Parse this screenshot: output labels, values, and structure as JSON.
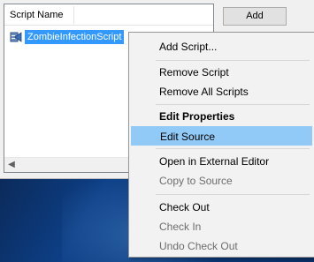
{
  "list": {
    "column_header": "Script Name",
    "items": [
      {
        "label": "ZombieInfectionScript",
        "icon": "script-icon",
        "selected": true
      }
    ]
  },
  "buttons": {
    "add_label": "Add"
  },
  "context_menu": {
    "items": [
      {
        "label": "Add Script...",
        "enabled": true
      },
      {
        "label": "Remove Script",
        "enabled": true
      },
      {
        "label": "Remove All Scripts",
        "enabled": true
      },
      {
        "label": "Edit Properties",
        "enabled": true,
        "bold": true
      },
      {
        "label": "Edit Source",
        "enabled": true,
        "highlighted": true
      },
      {
        "label": "Open in External Editor",
        "enabled": true
      },
      {
        "label": "Copy to Source",
        "enabled": false
      },
      {
        "label": "Check Out",
        "enabled": true
      },
      {
        "label": "Check In",
        "enabled": false
      },
      {
        "label": "Undo Check Out",
        "enabled": false
      }
    ]
  },
  "colors": {
    "selection": "#3399ff",
    "menu_highlight": "#91c9f7",
    "desktop": "#0d3f86"
  }
}
